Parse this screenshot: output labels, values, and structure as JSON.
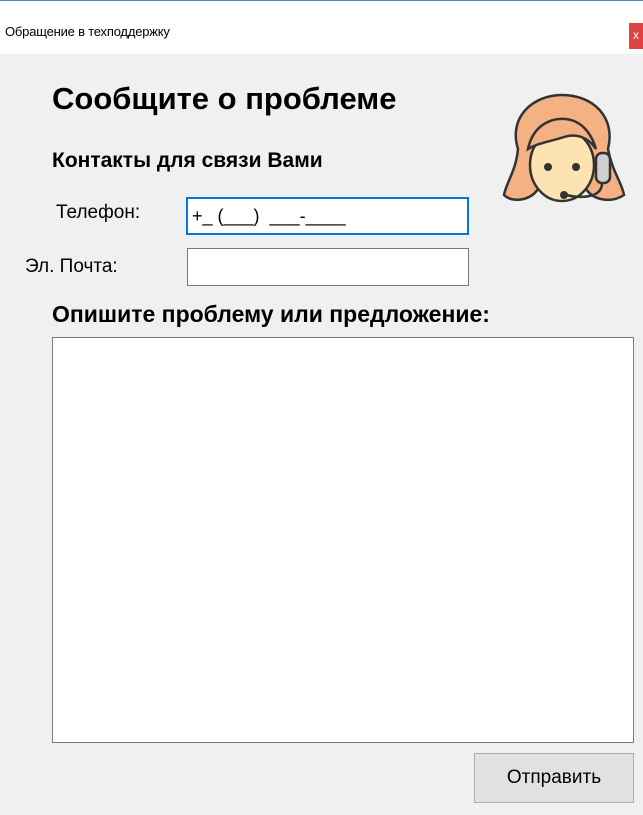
{
  "window": {
    "title": "Обращение в техподдержку",
    "close_glyph": "x"
  },
  "form": {
    "heading": "Сообщите о проблеме",
    "contacts_heading": "Контакты для связи Вами",
    "phone_label": "Телефон:",
    "phone_value": "+_ (___)  ___-____",
    "email_label": "Эл. Почта:",
    "email_value": "",
    "problem_label": "Опишите проблему или предложение:",
    "problem_value": "",
    "send_button": "Отправить"
  },
  "icons": {
    "avatar": "support-operator-avatar-icon",
    "close": "close-icon"
  },
  "colors": {
    "title_accent": "#3b8fd6",
    "close_bg": "#e04343",
    "focus_border": "#0078d7",
    "hair": "#f4b183",
    "skin": "#fde3b1"
  }
}
